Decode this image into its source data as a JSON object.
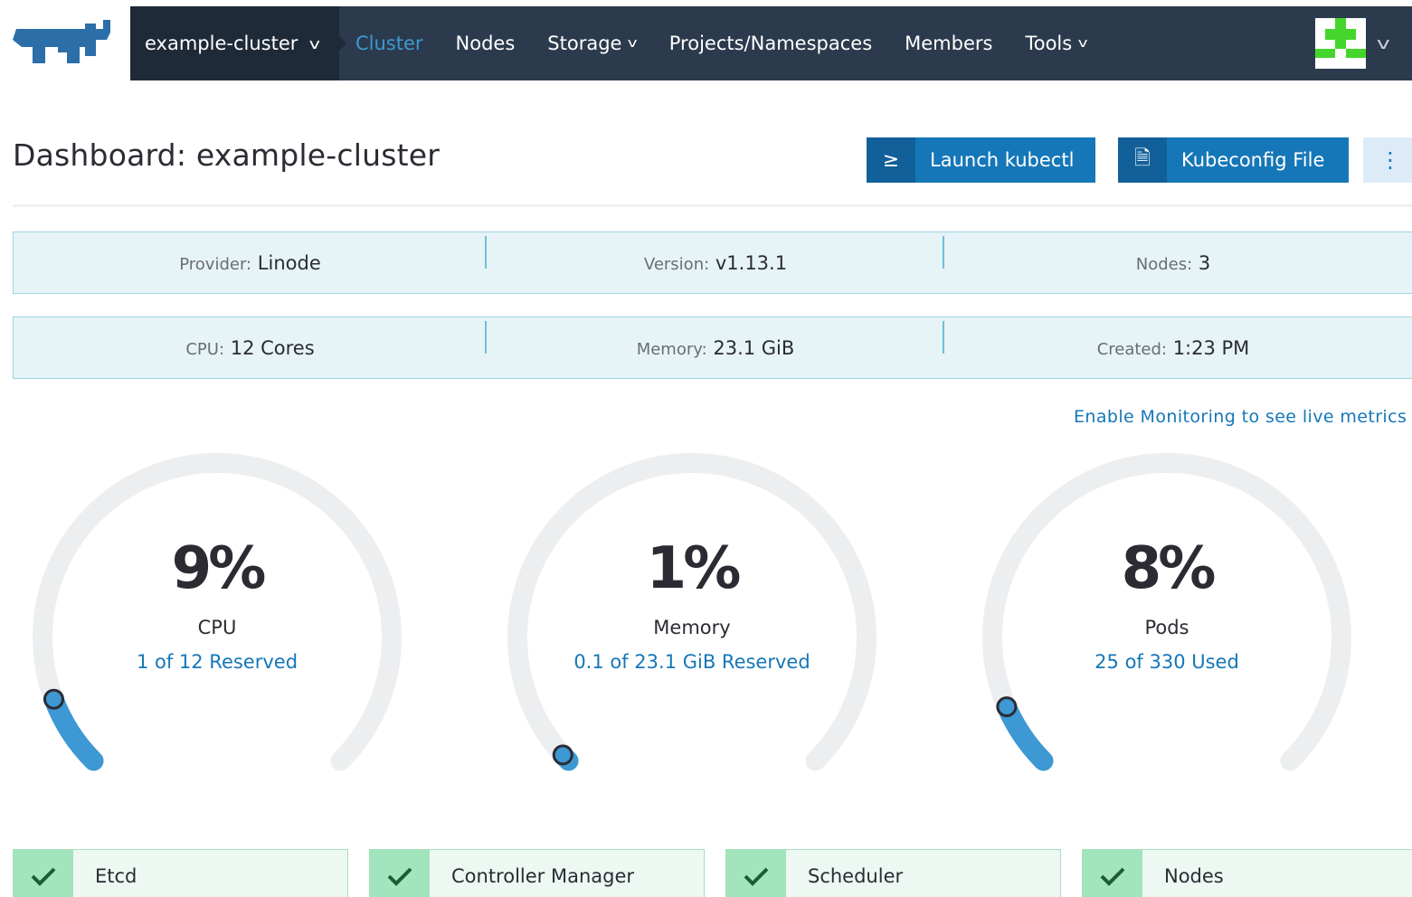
{
  "nav": {
    "cluster_name": "example-cluster",
    "items": [
      {
        "label": "Cluster",
        "active": true,
        "dropdown": false
      },
      {
        "label": "Nodes",
        "active": false,
        "dropdown": false
      },
      {
        "label": "Storage",
        "active": false,
        "dropdown": true
      },
      {
        "label": "Projects/Namespaces",
        "active": false,
        "dropdown": false
      },
      {
        "label": "Members",
        "active": false,
        "dropdown": false
      },
      {
        "label": "Tools",
        "active": false,
        "dropdown": true
      }
    ]
  },
  "header": {
    "title": "Dashboard: example-cluster",
    "launch_kubectl": "Launch kubectl",
    "kubeconfig_file": "Kubeconfig File"
  },
  "info": {
    "provider": {
      "key": "Provider:",
      "value": "Linode"
    },
    "version": {
      "key": "Version:",
      "value": "v1.13.1"
    },
    "nodes": {
      "key": "Nodes:",
      "value": "3"
    },
    "cpu": {
      "key": "CPU:",
      "value": "12 Cores"
    },
    "memory": {
      "key": "Memory:",
      "value": "23.1 GiB"
    },
    "created": {
      "key": "Created:",
      "value": "1:23 PM"
    }
  },
  "monitoring_link": "Enable Monitoring to see live metrics",
  "gauges": [
    {
      "percent": "9%",
      "fraction": 0.09,
      "label": "CPU",
      "detail": "1 of 12 Reserved"
    },
    {
      "percent": "1%",
      "fraction": 0.01,
      "label": "Memory",
      "detail": "0.1 of 23.1 GiB Reserved"
    },
    {
      "percent": "8%",
      "fraction": 0.08,
      "label": "Pods",
      "detail": "25 of 330 Used"
    }
  ],
  "components": [
    {
      "name": "Etcd",
      "status": "healthy"
    },
    {
      "name": "Controller Manager",
      "status": "healthy"
    },
    {
      "name": "Scheduler",
      "status": "healthy"
    },
    {
      "name": "Nodes",
      "status": "healthy"
    }
  ],
  "colors": {
    "nav_bg": "#2c3a4d",
    "accent": "#1577b8",
    "gauge_track": "#eceeef",
    "gauge_fill": "#3d98d3",
    "healthy": "#a2e4bc"
  }
}
